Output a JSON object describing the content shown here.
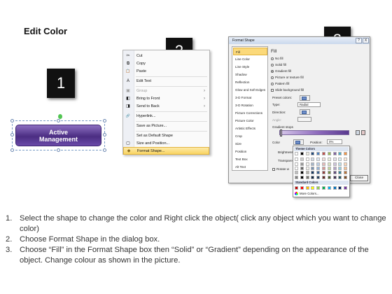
{
  "title": "Edit Color",
  "steps": [
    "1",
    "2",
    "3"
  ],
  "shape": {
    "line1": "Active",
    "line2": "Management"
  },
  "context_menu": {
    "items": [
      {
        "label": "Cut",
        "icon": "✂",
        "enabled": true
      },
      {
        "label": "Copy",
        "icon": "⧉",
        "enabled": true
      },
      {
        "label": "Paste",
        "icon": "📋",
        "enabled": true
      },
      {
        "label": "Edit Text",
        "icon": "A",
        "enabled": true
      },
      {
        "label": "Group",
        "icon": "▣",
        "enabled": false,
        "submenu": true
      },
      {
        "label": "Bring to Front",
        "icon": "◧",
        "enabled": true,
        "submenu": true
      },
      {
        "label": "Send to Back",
        "icon": "◨",
        "enabled": true,
        "submenu": true
      },
      {
        "label": "Hyperlink...",
        "icon": "🔗",
        "enabled": true
      },
      {
        "label": "Save as Picture...",
        "icon": "",
        "enabled": true
      },
      {
        "label": "Set as Default Shape",
        "icon": "",
        "enabled": true
      },
      {
        "label": "Size and Position...",
        "icon": "▢",
        "enabled": true
      },
      {
        "label": "Format Shape...",
        "icon": "◆",
        "enabled": true,
        "highlighted": true
      }
    ]
  },
  "format_dialog": {
    "title": "Format Shape",
    "help": "?",
    "close_x": "X",
    "nav": [
      "Fill",
      "Line Color",
      "Line Style",
      "Shadow",
      "Reflection",
      "Glow and Soft Edges",
      "3-D Format",
      "3-D Rotation",
      "Picture Corrections",
      "Picture Color",
      "Artistic Effects",
      "Crop",
      "Size",
      "Position",
      "Text Box",
      "Alt Text"
    ],
    "selected_nav": "Fill",
    "fill_heading": "Fill",
    "fill_options": [
      {
        "label": "No fill",
        "selected": false
      },
      {
        "label": "Solid fill",
        "selected": false
      },
      {
        "label": "Gradient fill",
        "selected": true
      },
      {
        "label": "Picture or texture fill",
        "selected": false
      },
      {
        "label": "Pattern fill",
        "selected": false
      }
    ],
    "slide_bg_label": "Slide background fill",
    "preset_label": "Preset colors:",
    "type_label": "Type:",
    "type_value": "Radial",
    "direction_label": "Direction:",
    "angle_label": "Angle:",
    "gradient_stops_label": "Gradient stops",
    "color_label": "Color",
    "position_label": "Position:",
    "position_value": "0%",
    "brightness_label": "Brightness",
    "transparency_label": "Transparency",
    "rotate_label": "Rotate w",
    "close_label": "Close"
  },
  "theme_popup": {
    "theme_header": "Theme Colors",
    "standard_header": "Standard Colors",
    "more_colors": "More Colors...",
    "theme_top": [
      "#ffffff",
      "#000000",
      "#eeece1",
      "#1f497d",
      "#4f81bd",
      "#c0504d",
      "#9bbb59",
      "#8064a2",
      "#4bacc6",
      "#f79646"
    ],
    "standard": [
      "#c00000",
      "#ff0000",
      "#ffc000",
      "#ffff00",
      "#92d050",
      "#00b050",
      "#00b0f0",
      "#0070c0",
      "#002060",
      "#7030a0"
    ]
  },
  "instructions": [
    {
      "num": "1.",
      "text": "Select the shape to change the color and Right click the object( click any object which you want to change color)"
    },
    {
      "num": "2.",
      "text": "Choose Format Shape in the dialog box."
    },
    {
      "num": "3.",
      "text": "Choose “Fill” in the Format Shape box then “Solid” or “Gradient” depending on the appearance of the object. Change colour as shown in the picture."
    }
  ]
}
